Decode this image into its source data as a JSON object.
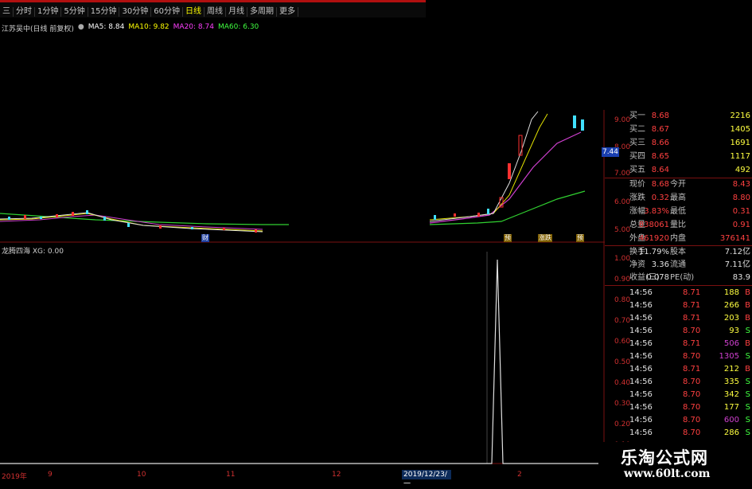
{
  "toolbar": {
    "tabs": [
      "三",
      "分时",
      "1分钟",
      "5分钟",
      "15分钟",
      "30分钟",
      "60分钟",
      "日线",
      "周线",
      "月线",
      "多周期",
      "更多"
    ],
    "active_tab": "日线"
  },
  "main_chart": {
    "title": "江苏吴中(日线 前复权)",
    "ma": [
      {
        "label": "MA5: 8.84",
        "color": "#ffffff"
      },
      {
        "label": "MA10: 9.82",
        "color": "#ffff00"
      },
      {
        "label": "MA20: 8.74",
        "color": "#ff40ff"
      },
      {
        "label": "MA60: 6.30",
        "color": "#40ff40"
      }
    ],
    "price_axis": [
      "9.00",
      "8.00",
      "7.00",
      "6.00",
      "5.00"
    ],
    "current_price_tag": "7.44",
    "signals": [
      "财",
      "预",
      "涨跌",
      "预"
    ]
  },
  "indicator": {
    "legend": "龙腾四海 XG: 0.00",
    "axis": [
      "1.00",
      "0.90",
      "0.80",
      "0.70",
      "0.60",
      "0.50",
      "0.40",
      "0.30",
      "0.20",
      "0.10",
      "0.00"
    ]
  },
  "dates": [
    "2019年",
    "9",
    "10",
    "11",
    "12",
    "2019/12/23/一",
    "2"
  ],
  "quote": {
    "bids": [
      {
        "label": "买一",
        "price": "8.68",
        "qty": "2216"
      },
      {
        "label": "买二",
        "price": "8.67",
        "qty": "1405"
      },
      {
        "label": "买三",
        "price": "8.66",
        "qty": "1691"
      },
      {
        "label": "买四",
        "price": "8.65",
        "qty": "1117"
      },
      {
        "label": "买五",
        "price": "8.64",
        "qty": "492"
      }
    ],
    "stats": [
      {
        "l1": "现价",
        "v1": "8.68",
        "l2": "今开",
        "v2": "8.43"
      },
      {
        "l1": "涨跌",
        "v1": "0.32",
        "l2": "最高",
        "v2": "8.80"
      },
      {
        "l1": "涨幅",
        "v1": "3.83%",
        "l2": "最低",
        "v2": "0.31"
      },
      {
        "l1": "总量",
        "v1": "838061",
        "l2": "量比",
        "v2": "0.91"
      },
      {
        "l1": "外盘",
        "v1": "461920",
        "l2": "内盘",
        "v2": "376141"
      }
    ],
    "fund": [
      {
        "l1": "换手",
        "v1": "11.79%",
        "l2": "股本",
        "v2": "7.12亿"
      },
      {
        "l1": "净资",
        "v1": "3.36",
        "l2": "流通",
        "v2": "7.11亿"
      },
      {
        "l1": "收益(三)",
        "v1": "0.078",
        "l2": "PE(动)",
        "v2": "83.9"
      }
    ],
    "ticks": [
      {
        "time": "14:56",
        "price": "8.71",
        "vol": "188",
        "bs": "B"
      },
      {
        "time": "14:56",
        "price": "8.71",
        "vol": "266",
        "bs": "B"
      },
      {
        "time": "14:56",
        "price": "8.71",
        "vol": "203",
        "bs": "B"
      },
      {
        "time": "14:56",
        "price": "8.70",
        "vol": "93",
        "bs": "S"
      },
      {
        "time": "14:56",
        "price": "8.71",
        "vol": "506",
        "bs": "B"
      },
      {
        "time": "14:56",
        "price": "8.70",
        "vol": "1305",
        "bs": "S"
      },
      {
        "time": "14:56",
        "price": "8.71",
        "vol": "212",
        "bs": "B"
      },
      {
        "time": "14:56",
        "price": "8.70",
        "vol": "335",
        "bs": "S"
      },
      {
        "time": "14:56",
        "price": "8.70",
        "vol": "342",
        "bs": "S"
      },
      {
        "time": "14:56",
        "price": "8.70",
        "vol": "177",
        "bs": "S"
      },
      {
        "time": "14:56",
        "price": "8.70",
        "vol": "600",
        "bs": "S"
      },
      {
        "time": "14:56",
        "price": "8.70",
        "vol": "286",
        "bs": "S"
      }
    ]
  },
  "watermark": {
    "cn": "乐淘公式网",
    "url": "www.60lt.com"
  }
}
